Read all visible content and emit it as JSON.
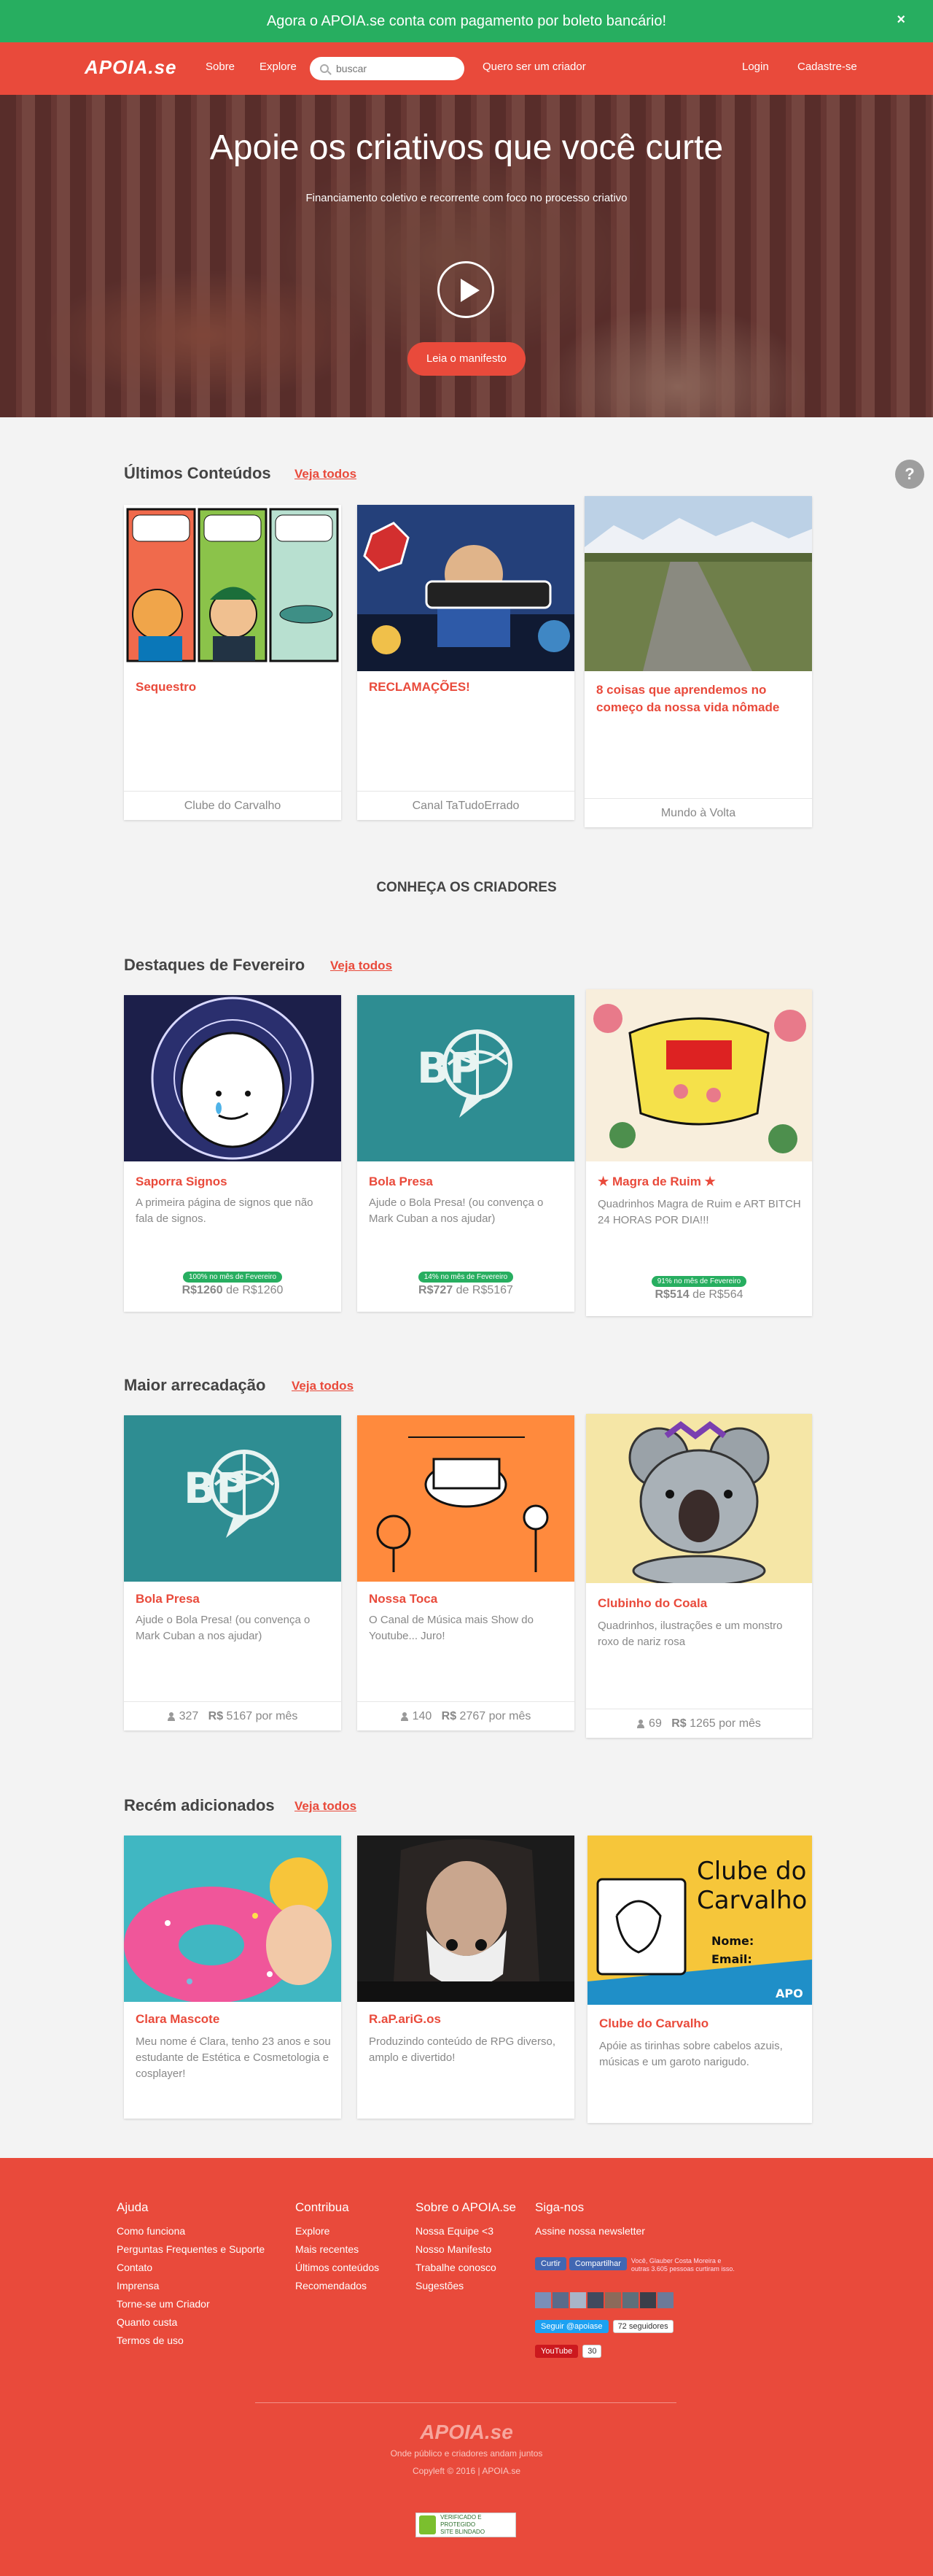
{
  "banner": {
    "text": "Agora o APOIA.se conta com pagamento por boleto bancário!",
    "close": "×"
  },
  "nav": {
    "logo": "APOIA.se",
    "links": [
      "Sobre",
      "Explore"
    ],
    "search_placeholder": "buscar",
    "creator_link": "Quero ser um criador",
    "login": "Login",
    "signup": "Cadastre-se"
  },
  "hero": {
    "title": "Apoie os criativos que você curte",
    "subtitle": "Financiamento coletivo e recorrente com foco no processo criativo",
    "button": "Leia o manifesto"
  },
  "help_icon": "?",
  "latest": {
    "title": "Últimos Conteúdos",
    "see_all": "Veja todos",
    "cards": [
      {
        "title": "Sequestro",
        "creator": "Clube do Carvalho"
      },
      {
        "title": "RECLAMAÇÕES!",
        "creator": "Canal TaTudoErrado"
      },
      {
        "title": "8 coisas que aprendemos no começo da nossa vida nômade",
        "creator": "Mundo à Volta"
      }
    ]
  },
  "meet_creators": "CONHEÇA OS CRIADORES",
  "highlights": {
    "title": "Destaques de Fevereiro",
    "see_all": "Veja todos",
    "cards": [
      {
        "title": "Saporra Signos",
        "desc": "A primeira página de signos que não fala de signos.",
        "badge": "100% no mês de Fevereiro",
        "raised": "R$1260",
        "of": "de",
        "goal": "R$1260",
        "pct": 100
      },
      {
        "title": "Bola Presa",
        "desc": "Ajude o Bola Presa! (ou convença o Mark Cuban a nos ajudar)",
        "badge": "14% no mês de Fevereiro",
        "raised": "R$727",
        "of": "de",
        "goal": "R$5167",
        "pct": 14
      },
      {
        "title": "★ Magra de Ruim ★",
        "desc": "Quadrinhos Magra de Ruim e ART BITCH 24 HORAS POR DIA!!!",
        "badge": "91% no mês de Fevereiro",
        "raised": "R$514",
        "of": "de",
        "goal": "R$564",
        "pct": 91
      }
    ]
  },
  "top_raised": {
    "title": "Maior arrecadação",
    "see_all": "Veja todos",
    "cards": [
      {
        "title": "Bola Presa",
        "desc": "Ajude o Bola Presa! (ou convença o Mark Cuban a nos ajudar)",
        "supporters": "327",
        "currency": "R$",
        "amount": "5167 por mês"
      },
      {
        "title": "Nossa Toca",
        "desc": "O Canal de Música mais Show do Youtube... Juro!",
        "supporters": "140",
        "currency": "R$",
        "amount": "2767 por mês"
      },
      {
        "title": "Clubinho do Coala",
        "desc": "Quadrinhos, ilustrações e um monstro roxo de nariz rosa",
        "supporters": "69",
        "currency": "R$",
        "amount": "1265 por mês"
      }
    ]
  },
  "recent": {
    "title": "Recém adicionados",
    "see_all": "Veja todos",
    "cards": [
      {
        "title": "Clara Mascote",
        "desc": "Meu nome é Clara, tenho 23 anos e sou estudante de Estética e Cosmetologia e cosplayer!"
      },
      {
        "title": "R.aP.ariG.os",
        "desc": "Produzindo conteúdo de RPG diverso, amplo e divertido!"
      },
      {
        "title": "Clube do Carvalho",
        "desc": "Apóie as tirinhas sobre cabelos azuis, músicas e um garoto narigudo."
      }
    ]
  },
  "footer": {
    "help": {
      "title": "Ajuda",
      "links": [
        "Como funciona",
        "Perguntas Frequentes e Suporte",
        "Contato",
        "Imprensa",
        "Torne-se um Criador",
        "Quanto custa",
        "Termos de uso"
      ]
    },
    "contribute": {
      "title": "Contribua",
      "links": [
        "Explore",
        "Mais recentes",
        "Últimos conteúdos",
        "Recomendados"
      ]
    },
    "about": {
      "title": "Sobre o APOIA.se",
      "links": [
        "Nossa Equipe <3",
        "Nosso Manifesto",
        "Trabalhe conosco",
        "Sugestões"
      ]
    },
    "follow": {
      "title": "Siga-nos",
      "newsletter": "Assine nossa newsletter",
      "fb_like": "Curtir",
      "fb_share": "Compartilhar",
      "fb_text": "Você, Glauber Costa Moreira e outras 3.605 pessoas curtiram isso.",
      "twitter": "Seguir @apoiase",
      "twitter_count": "72 seguidores",
      "youtube": "YouTube",
      "youtube_count": "30"
    },
    "logo": "APOIA.se",
    "tagline": "Onde público e criadores andam juntos",
    "copyright": "Copyleft © 2016 | APOIA.se",
    "seal_line1": "VERIFICADO E PROTEGIDO",
    "seal_line2": "SITE BLINDADO"
  },
  "colors": {
    "brand": "#e94a3b",
    "success": "#27ae60",
    "background": "#f3f3f3"
  }
}
